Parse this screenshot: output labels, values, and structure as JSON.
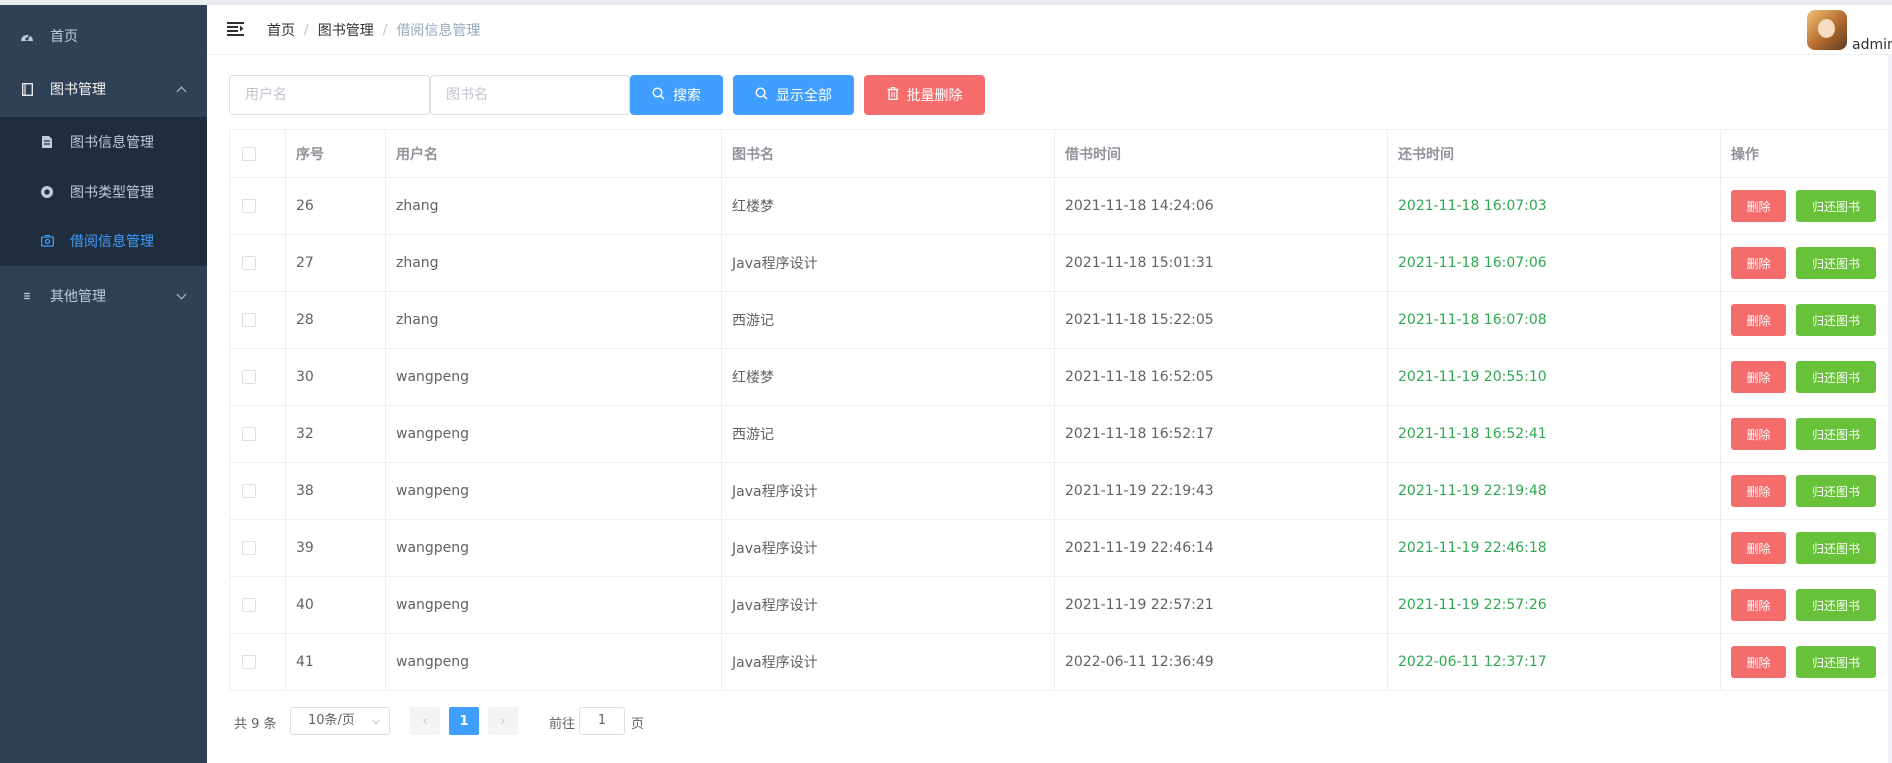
{
  "sidebar": {
    "items": [
      {
        "label": "首页",
        "icon": "dashboard-icon"
      },
      {
        "label": "图书管理",
        "icon": "book-icon",
        "expanded": true
      },
      {
        "label": "其他管理",
        "icon": "list-icon",
        "expanded": false
      }
    ],
    "submenu": [
      {
        "label": "图书信息管理",
        "icon": "document-icon"
      },
      {
        "label": "图书类型管理",
        "icon": "lifebuoy-icon"
      },
      {
        "label": "借阅信息管理",
        "icon": "ticket-icon",
        "active": true
      }
    ]
  },
  "header": {
    "breadcrumb": [
      "首页",
      "图书管理",
      "借阅信息管理"
    ],
    "user": "admin"
  },
  "toolbar": {
    "username_placeholder": "用户名",
    "bookname_placeholder": "图书名",
    "search_label": "搜索",
    "show_all_label": "显示全部",
    "batch_delete_label": "批量删除"
  },
  "table": {
    "headers": {
      "id": "序号",
      "user": "用户名",
      "book": "图书名",
      "borrow": "借书时间",
      "return": "还书时间",
      "ops": "操作"
    },
    "delete_label": "删除",
    "return_label": "归还图书",
    "rows": [
      {
        "id": "26",
        "user": "zhang",
        "book": "红楼梦",
        "borrow": "2021-11-18 14:24:06",
        "return": "2021-11-18 16:07:03"
      },
      {
        "id": "27",
        "user": "zhang",
        "book": "Java程序设计",
        "borrow": "2021-11-18 15:01:31",
        "return": "2021-11-18 16:07:06"
      },
      {
        "id": "28",
        "user": "zhang",
        "book": "西游记",
        "borrow": "2021-11-18 15:22:05",
        "return": "2021-11-18 16:07:08"
      },
      {
        "id": "30",
        "user": "wangpeng",
        "book": "红楼梦",
        "borrow": "2021-11-18 16:52:05",
        "return": "2021-11-19 20:55:10"
      },
      {
        "id": "32",
        "user": "wangpeng",
        "book": "西游记",
        "borrow": "2021-11-18 16:52:17",
        "return": "2021-11-18 16:52:41"
      },
      {
        "id": "38",
        "user": "wangpeng",
        "book": "Java程序设计",
        "borrow": "2021-11-19 22:19:43",
        "return": "2021-11-19 22:19:48"
      },
      {
        "id": "39",
        "user": "wangpeng",
        "book": "Java程序设计",
        "borrow": "2021-11-19 22:46:14",
        "return": "2021-11-19 22:46:18"
      },
      {
        "id": "40",
        "user": "wangpeng",
        "book": "Java程序设计",
        "borrow": "2021-11-19 22:57:21",
        "return": "2021-11-19 22:57:26"
      },
      {
        "id": "41",
        "user": "wangpeng",
        "book": "Java程序设计",
        "borrow": "2022-06-11 12:36:49",
        "return": "2022-06-11 12:37:17"
      }
    ]
  },
  "pagination": {
    "total": "共 9 条",
    "page_size": "10条/页",
    "current_page": "1",
    "goto_label": "前往",
    "goto_value": "1",
    "page_unit": "页"
  },
  "colors": {
    "sidebar_bg": "#304156",
    "submenu_bg": "#1f2d3d",
    "active": "#409eff",
    "danger": "#f56c6c",
    "success": "#67c23a",
    "return_text": "#2fa84f"
  }
}
